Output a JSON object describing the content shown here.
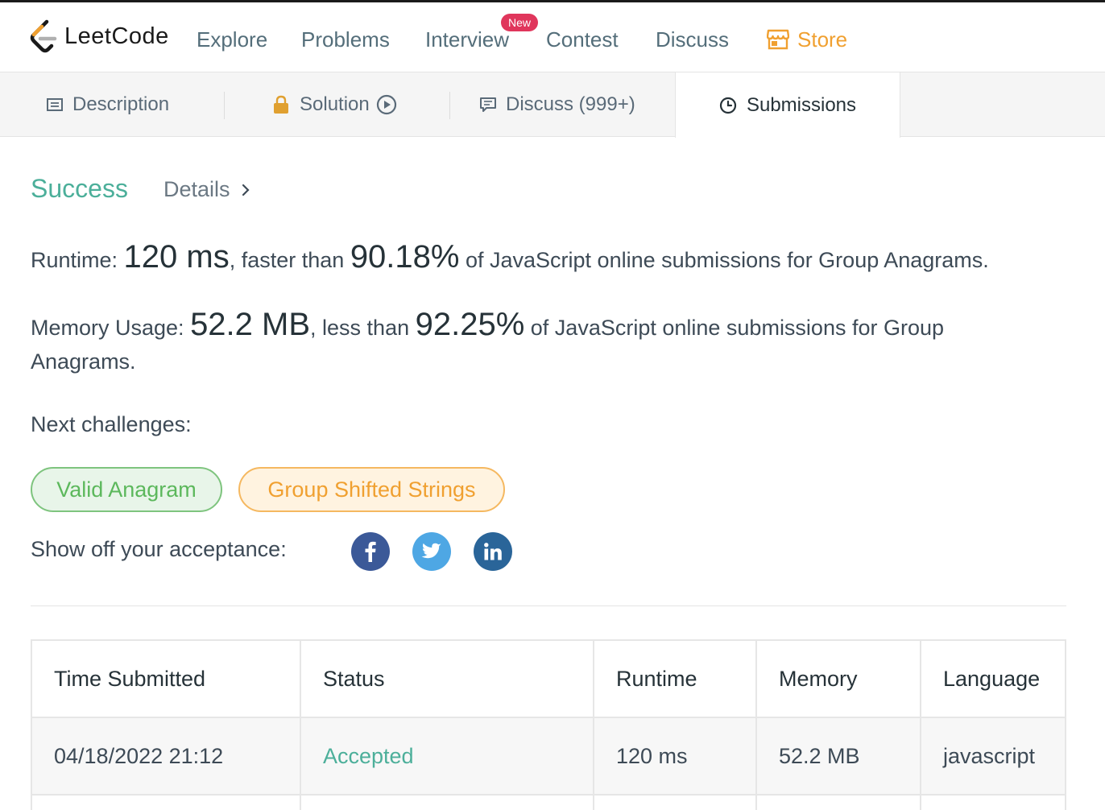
{
  "nav": {
    "logo_text": "LeetCode",
    "items": [
      "Explore",
      "Problems",
      "Interview",
      "Contest",
      "Discuss"
    ],
    "new_badge": "New",
    "store_label": "Store",
    "store_color": "#f0a030"
  },
  "tabs": {
    "description": "Description",
    "solution": "Solution",
    "discuss": "Discuss (999+)",
    "submissions": "Submissions"
  },
  "result": {
    "status": "Success",
    "details_label": "Details",
    "runtime_label": "Runtime: ",
    "runtime_value": "120 ms",
    "runtime_mid": ", faster than ",
    "runtime_percent": "90.18%",
    "runtime_tail": " of JavaScript online submissions for Group Anagrams.",
    "memory_label": "Memory Usage: ",
    "memory_value": "52.2 MB",
    "memory_mid": ", less than ",
    "memory_percent": "92.25%",
    "memory_tail_line1": " of JavaScript online submissions for Group",
    "memory_tail_line2": "Anagrams."
  },
  "next": {
    "label": "Next challenges:",
    "challenges": [
      "Valid Anagram",
      "Group Shifted Strings"
    ]
  },
  "share": {
    "label": "Show off your acceptance:",
    "icons": [
      "facebook-icon",
      "twitter-icon",
      "linkedin-icon"
    ]
  },
  "table": {
    "headers": [
      "Time Submitted",
      "Status",
      "Runtime",
      "Memory",
      "Language"
    ],
    "rows": [
      [
        "04/18/2022 21:12",
        "Accepted",
        "120 ms",
        "52.2 MB",
        "javascript"
      ]
    ]
  },
  "colors": {
    "success": "#4caf9a",
    "facebook": "#3b5998",
    "twitter": "#4ea7e4",
    "linkedin": "#2a6599",
    "new_badge": "#e0365c"
  }
}
